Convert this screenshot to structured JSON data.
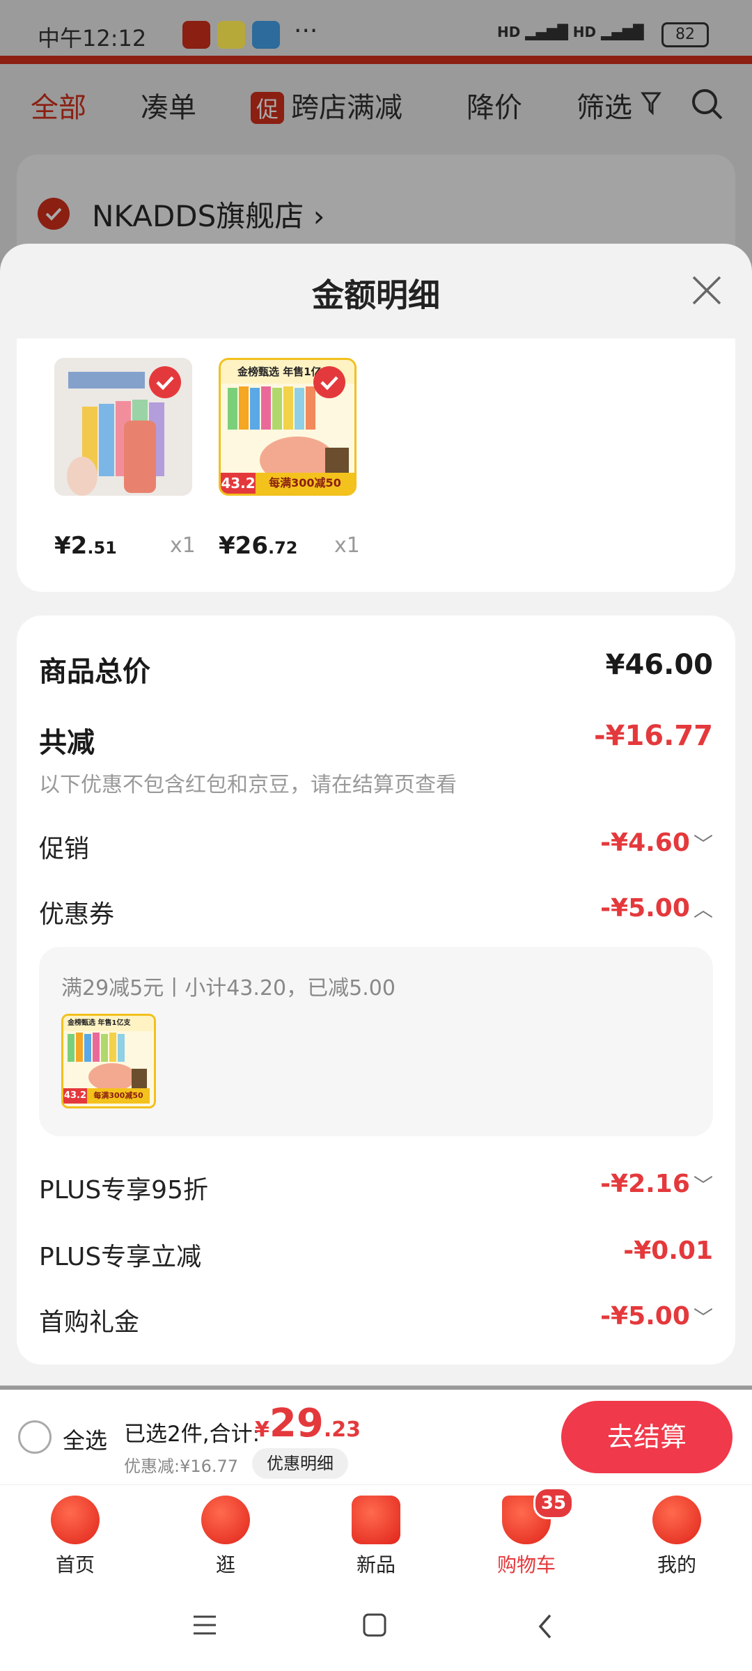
{
  "status": {
    "time": "中午12:12",
    "battery": "82",
    "more": "···"
  },
  "bg": {
    "tabs": [
      "全部",
      "凑单",
      "跨店满减",
      "降价",
      "筛选"
    ],
    "promo_badge": "促",
    "store_name": "NKADDS旗舰店",
    "store_arrow": "›"
  },
  "modal": {
    "title": "金额明细",
    "products": [
      {
        "price_int": "¥2",
        "price_dec": ".51",
        "qty": "x1"
      },
      {
        "price_int": "¥26",
        "price_dec": ".72",
        "qty": "x1"
      }
    ],
    "product2_banner": "金榜甄选 年售1亿",
    "product2_tag": "每满300减50",
    "product2_price": "43.2",
    "total_label": "商品总价",
    "total_value": "¥46.00",
    "reduce_label": "共减",
    "reduce_value": "-¥16.77",
    "note": "以下优惠不包含红包和京豆，请在结算页查看",
    "rows": [
      {
        "label": "促销",
        "value": "-¥4.60",
        "chevron": "﹀"
      },
      {
        "label": "优惠券",
        "value": "-¥5.00",
        "chevron": "︿"
      },
      {
        "label": "PLUS专享95折",
        "value": "-¥2.16",
        "chevron": "﹀"
      },
      {
        "label": "PLUS专享立减",
        "value": "-¥0.01",
        "chevron": ""
      },
      {
        "label": "首购礼金",
        "value": "-¥5.00",
        "chevron": "﹀"
      }
    ],
    "coupon_detail": "满29减5元丨小计43.20，已减5.00",
    "coupon_thumb_banner": "金榜甄选 年售1亿支",
    "coupon_thumb_tag": "每满300减50",
    "coupon_thumb_price": "43.2"
  },
  "checkout": {
    "select_all": "全选",
    "selected": "已选2件,合计:",
    "currency": "¥",
    "total_int": "29",
    "total_dec": ".23",
    "discount": "优惠减:¥16.77",
    "detail_btn": "优惠明细",
    "pay_btn": "去结算"
  },
  "tabbar": {
    "items": [
      "首页",
      "逛",
      "新品",
      "购物车",
      "我的"
    ],
    "cart_badge": "35"
  },
  "colors": {
    "accent": "#e4393c",
    "button": "#f0394a"
  }
}
